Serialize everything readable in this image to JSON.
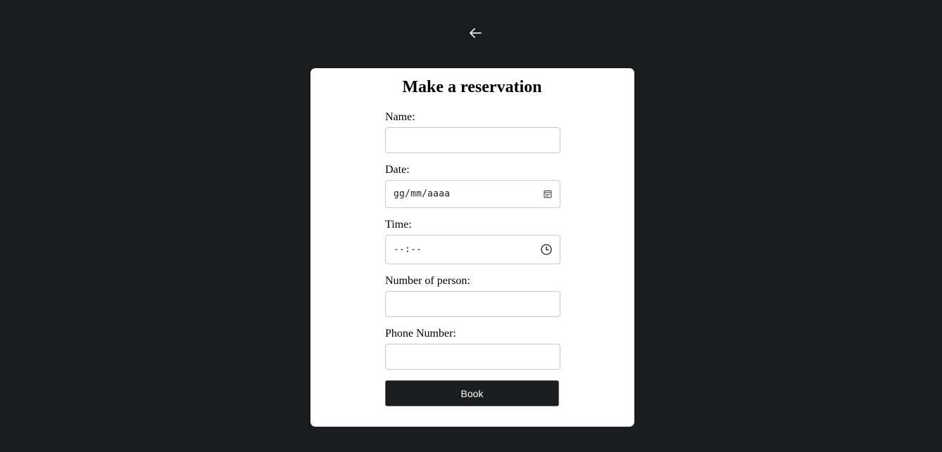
{
  "header": {
    "back_icon": "arrow-left-icon"
  },
  "form": {
    "title": "Make a reservation",
    "name": {
      "label": "Name:",
      "value": ""
    },
    "date": {
      "label": "Date:",
      "placeholder": "gg/mm/aaaa",
      "icon": "calendar-icon"
    },
    "time": {
      "label": "Time:",
      "placeholder": "--:--",
      "icon": "clock-icon"
    },
    "persons": {
      "label": "Number of person:",
      "value": ""
    },
    "phone": {
      "label": "Phone Number:",
      "value": ""
    },
    "submit_label": "Book"
  },
  "colors": {
    "background": "#1b1c1e",
    "card": "#ffffff",
    "button": "#1c1d1f",
    "input_border": "#c9c9c9"
  }
}
